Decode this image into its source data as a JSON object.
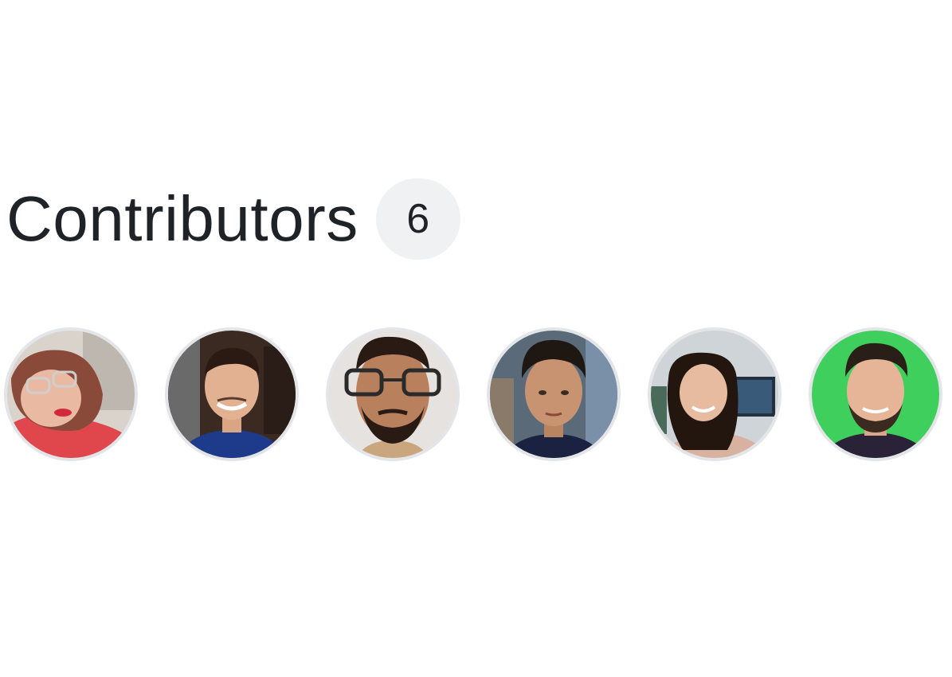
{
  "contributors": {
    "title": "Contributors",
    "count": "6",
    "avatars": [
      {
        "icon": "avatar-photo-icon",
        "bg": "#d9d3cc"
      },
      {
        "icon": "avatar-photo-icon",
        "bg": "#3b2a22"
      },
      {
        "icon": "avatar-photo-icon",
        "bg": "#e6e2df"
      },
      {
        "icon": "avatar-photo-icon",
        "bg": "#5a6a78"
      },
      {
        "icon": "avatar-photo-icon",
        "bg": "#cfd4d8"
      },
      {
        "icon": "avatar-photo-icon",
        "bg": "#3fcf5c"
      }
    ]
  },
  "colors": {
    "text": "#1f2328",
    "counter_bg": "#eff1f3",
    "avatar_border": "#e3e5e8"
  }
}
